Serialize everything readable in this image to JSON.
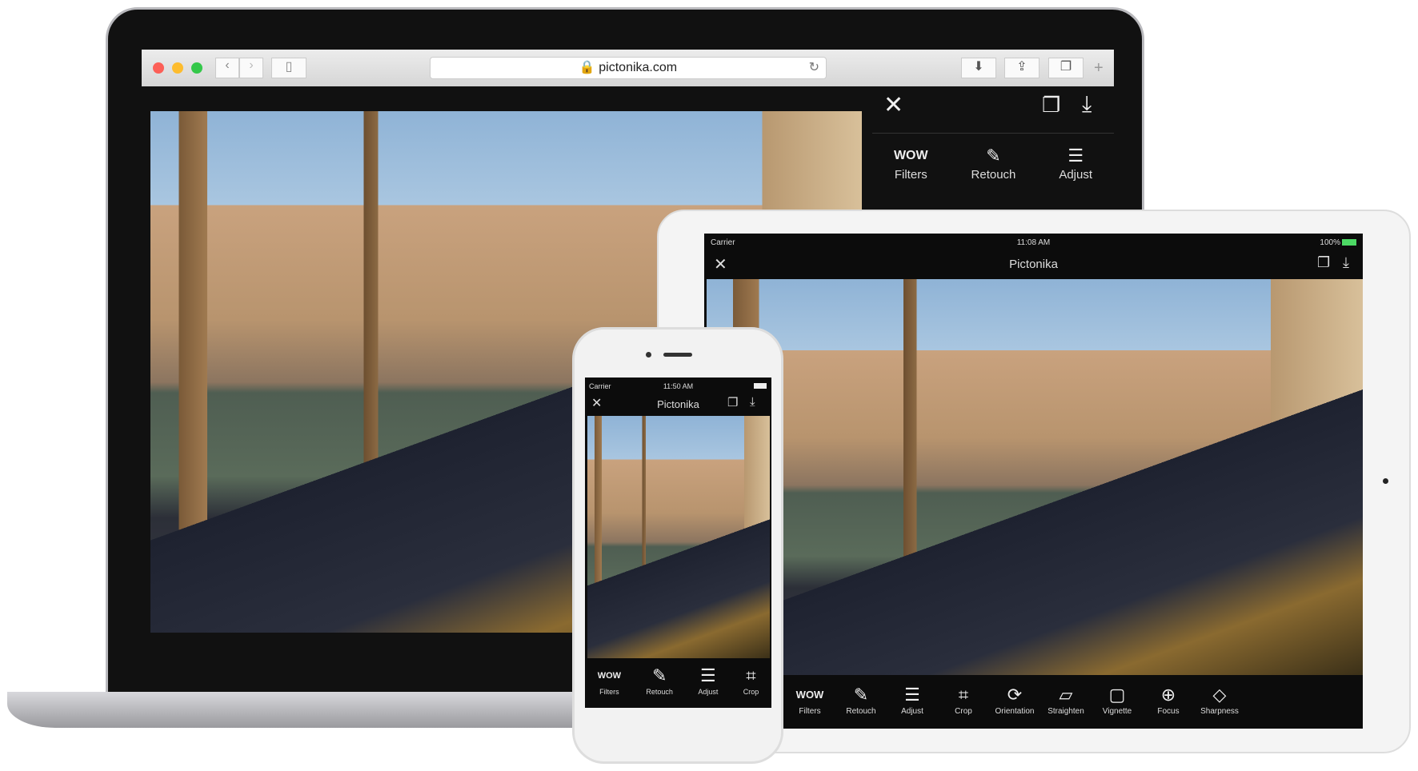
{
  "laptop": {
    "browser": {
      "url": "pictonika.com",
      "traffic_lights": [
        "#fc5f57",
        "#fdbc2e",
        "#34c84a"
      ]
    },
    "panel": {
      "tools": [
        {
          "label": "Filters",
          "icon": "wow-icon"
        },
        {
          "label": "Retouch",
          "icon": "brush-icon"
        },
        {
          "label": "Adjust",
          "icon": "sliders-icon"
        }
      ]
    }
  },
  "ipad": {
    "status": {
      "carrier": "Carrier",
      "time": "11:08 AM",
      "battery": "100%"
    },
    "title": "Pictonika",
    "tools": [
      {
        "label": "Filters",
        "icon": "WOW"
      },
      {
        "label": "Retouch",
        "icon": "✎"
      },
      {
        "label": "Adjust",
        "icon": "☰"
      },
      {
        "label": "Crop",
        "icon": "⌗"
      },
      {
        "label": "Orientation",
        "icon": "⟳"
      },
      {
        "label": "Straighten",
        "icon": "▱"
      },
      {
        "label": "Vignette",
        "icon": "▢"
      },
      {
        "label": "Focus",
        "icon": "⊕"
      },
      {
        "label": "Sharpness",
        "icon": "◇"
      }
    ]
  },
  "iphone": {
    "status": {
      "carrier": "Carrier",
      "time": "11:50 AM"
    },
    "title": "Pictonika",
    "tools": [
      {
        "label": "Filters",
        "icon": "WOW"
      },
      {
        "label": "Retouch",
        "icon": "✎"
      },
      {
        "label": "Adjust",
        "icon": "☰"
      },
      {
        "label": "Crop",
        "icon": "⌗"
      }
    ]
  }
}
